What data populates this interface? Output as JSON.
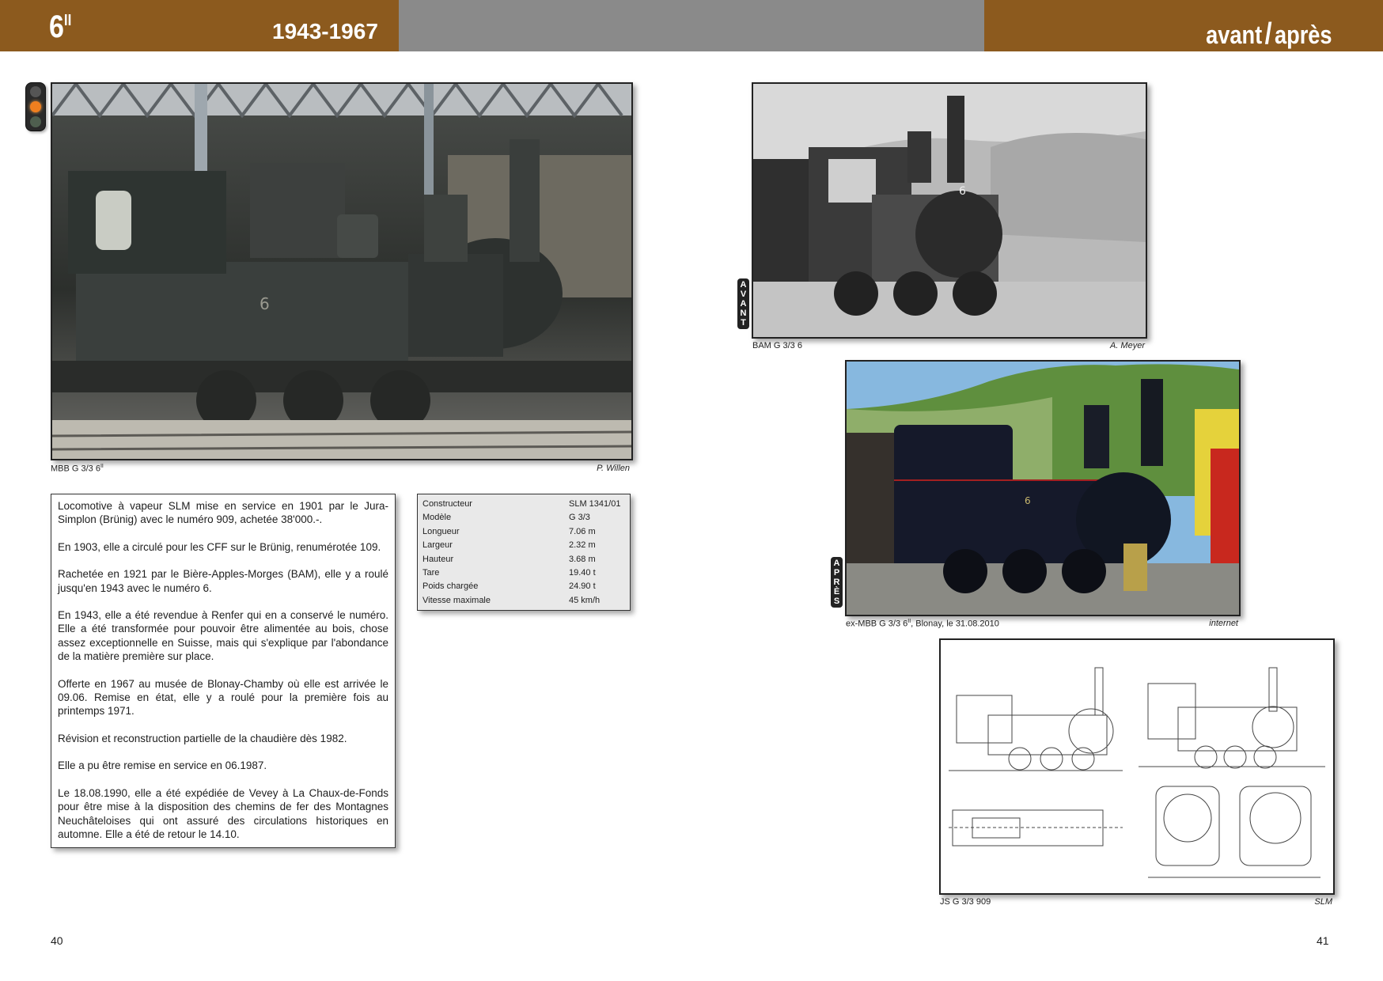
{
  "header": {
    "number": "6",
    "number_sup": "II",
    "years": "1943-1967",
    "title_left": "avant",
    "title_sep": "/",
    "title_right": "après"
  },
  "photos": {
    "main": {
      "caption": "MBB G 3/3 6",
      "caption_sup": "II",
      "credit": "P. Willen"
    },
    "avant": {
      "caption": "BAM G 3/3 6",
      "credit": "A. Meyer",
      "label": [
        "A",
        "V",
        "A",
        "N",
        "T"
      ]
    },
    "apres": {
      "caption_pre": "ex-MBB G 3/3 6",
      "caption_sup": "II",
      "caption_post": ", Blonay, le 31.08.2010",
      "credit": "internet",
      "label": [
        "A",
        "P",
        "R",
        "È",
        "S"
      ]
    },
    "drawing": {
      "caption": "JS G 3/3 909",
      "credit": "SLM"
    }
  },
  "text": [
    "Locomotive à vapeur SLM mise en service en 1901 par le Jura-Simplon (Brünig) avec le numéro 909, achetée 38'000.-.",
    "En 1903, elle a circulé pour les CFF sur le Brünig, renumérotée 109.",
    "Rachetée en 1921 par le Bière-Apples-Morges (BAM), elle y a roulé jusqu'en 1943 avec le numéro 6.",
    "En 1943, elle a été revendue à Renfer qui en a conservé le numéro. Elle a été transformée pour pouvoir être alimentée au bois, chose assez exceptionnelle en Suisse, mais qui s'explique par l'abondance de la matière première sur place.",
    "Offerte en 1967 au musée de Blonay-Chamby où elle est arrivée le 09.06. Remise en état, elle y a roulé pour la première fois au printemps 1971.",
    "Révision et reconstruction partielle de la chaudière dès 1982.",
    "Elle a pu être remise en service en 06.1987.",
    "Le 18.08.1990, elle a été expédiée de Vevey à La Chaux-de-Fonds pour être mise à la disposition des chemins de fer des Montagnes Neuchâteloises qui ont assuré des circulations historiques en automne. Elle a été de retour le 14.10."
  ],
  "specs": [
    {
      "k": "Constructeur",
      "v": "SLM 1341/01"
    },
    {
      "k": "Modèle",
      "v": "G 3/3"
    },
    {
      "k": "Longueur",
      "v": "7.06 m"
    },
    {
      "k": "Largeur",
      "v": "2.32 m"
    },
    {
      "k": "Hauteur",
      "v": "3.68 m"
    },
    {
      "k": "Tare",
      "v": "19.40 t"
    },
    {
      "k": "Poids chargée",
      "v": "24.90 t"
    },
    {
      "k": "Vitesse maximale",
      "v": "45 km/h"
    }
  ],
  "pages": {
    "left": "40",
    "right": "41"
  },
  "colors": {
    "brand_brown": "#8c5a1e",
    "band_grey": "#8a8a8a",
    "spec_bg": "#e9e9e9"
  }
}
